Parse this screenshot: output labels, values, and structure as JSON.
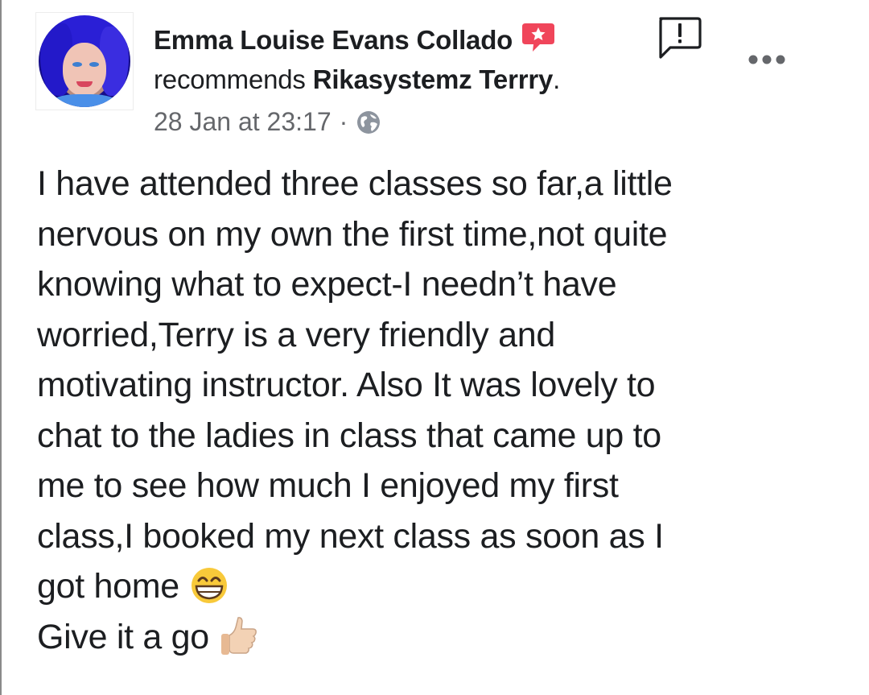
{
  "post": {
    "author": "Emma Louise Evans Collado",
    "action": "recommends",
    "page_name": "Rikasystemz Terrry",
    "period": ".",
    "timestamp": "28 Jan at 23:17",
    "separator": "·",
    "audience_icon": "globe-icon",
    "recommendation_icon": "recommendation-star-icon",
    "report_icon": "report-icon",
    "menu_icon": "more-options-icon",
    "lines": [
      "I have attended three classes so far,a little",
      "nervous on my own the first time,not quite",
      "knowing what to expect-I needn’t have",
      "worried,Terry is a very friendly and",
      "motivating instructor. Also It was lovely to",
      "chat to the ladies in class that came up to",
      "me to see how much I enjoyed my first",
      "class,I booked my next class as soon as I",
      "got home",
      "Give it a go"
    ],
    "emojis": [
      "grinning-face-emoji",
      "thumbs-up-emoji"
    ]
  },
  "colors": {
    "text": "#1c1e21",
    "secondary_text": "#65676b",
    "recommend_red": "#f0455a",
    "avatar_hair": "#2a1fd6"
  }
}
